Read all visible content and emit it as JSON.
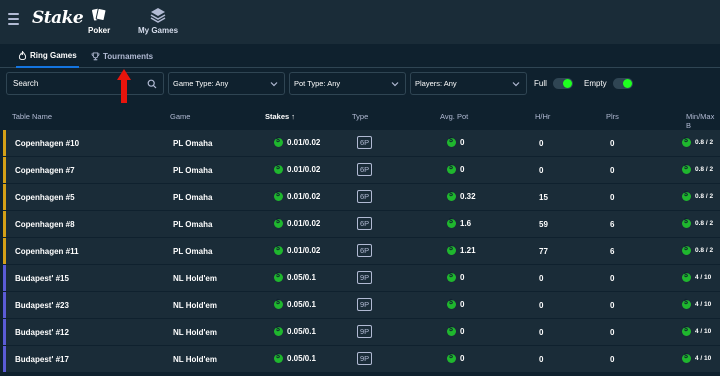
{
  "header": {
    "logo": "Stake",
    "nav": [
      {
        "label": "Poker",
        "icon": "cards-icon"
      },
      {
        "label": "My Games",
        "icon": "stack-icon"
      }
    ]
  },
  "tabs": [
    {
      "label": "Ring Games",
      "icon": "fire-icon",
      "active": true
    },
    {
      "label": "Tournaments",
      "icon": "trophy-icon",
      "active": false
    }
  ],
  "filters": {
    "search_placeholder": "Search",
    "game_type": "Game Type: Any",
    "pot_type": "Pot Type: Any",
    "players": "Players: Any",
    "full_label": "Full",
    "empty_label": "Empty"
  },
  "table": {
    "headers": {
      "name": "Table Name",
      "game": "Game",
      "stakes": "Stakes ↑",
      "type": "Type",
      "pot": "Avg. Pot",
      "hhr": "H/Hr",
      "plrs": "Plrs",
      "minmax": "Min/Max B"
    },
    "rows": [
      {
        "name": "Copenhagen #10",
        "game": "PL Omaha",
        "stakes": "0.01/0.02",
        "type": "6P",
        "pot": "0",
        "hhr": "0",
        "plrs": "0",
        "minmax": "0.8 / 2",
        "group": "plo"
      },
      {
        "name": "Copenhagen #7",
        "game": "PL Omaha",
        "stakes": "0.01/0.02",
        "type": "6P",
        "pot": "0",
        "hhr": "0",
        "plrs": "0",
        "minmax": "0.8 / 2",
        "group": "plo"
      },
      {
        "name": "Copenhagen #5",
        "game": "PL Omaha",
        "stakes": "0.01/0.02",
        "type": "6P",
        "pot": "0.32",
        "hhr": "15",
        "plrs": "0",
        "minmax": "0.8 / 2",
        "group": "plo"
      },
      {
        "name": "Copenhagen #8",
        "game": "PL Omaha",
        "stakes": "0.01/0.02",
        "type": "6P",
        "pot": "1.6",
        "hhr": "59",
        "plrs": "6",
        "minmax": "0.8 / 2",
        "group": "plo"
      },
      {
        "name": "Copenhagen #11",
        "game": "PL Omaha",
        "stakes": "0.01/0.02",
        "type": "6P",
        "pot": "1.21",
        "hhr": "77",
        "plrs": "6",
        "minmax": "0.8 / 2",
        "group": "plo"
      },
      {
        "name": "Budapest' #15",
        "game": "NL Hold'em",
        "stakes": "0.05/0.1",
        "type": "9P",
        "pot": "0",
        "hhr": "0",
        "plrs": "0",
        "minmax": "4 / 10",
        "group": "nl"
      },
      {
        "name": "Budapest' #23",
        "game": "NL Hold'em",
        "stakes": "0.05/0.1",
        "type": "9P",
        "pot": "0",
        "hhr": "0",
        "plrs": "0",
        "minmax": "4 / 10",
        "group": "nl"
      },
      {
        "name": "Budapest' #12",
        "game": "NL Hold'em",
        "stakes": "0.05/0.1",
        "type": "9P",
        "pot": "0",
        "hhr": "0",
        "plrs": "0",
        "minmax": "4 / 10",
        "group": "nl"
      },
      {
        "name": "Budapest' #17",
        "game": "NL Hold'em",
        "stakes": "0.05/0.1",
        "type": "9P",
        "pot": "0",
        "hhr": "0",
        "plrs": "0",
        "minmax": "4 / 10",
        "group": "nl"
      }
    ]
  },
  "colors": {
    "accent": "#1475e1",
    "plo_group": "#d4a017",
    "nl_group": "#5b5bd6",
    "coin": "#1fb72e",
    "toggle_on": "#1fff20",
    "annotation_arrow": "#e8140c"
  }
}
